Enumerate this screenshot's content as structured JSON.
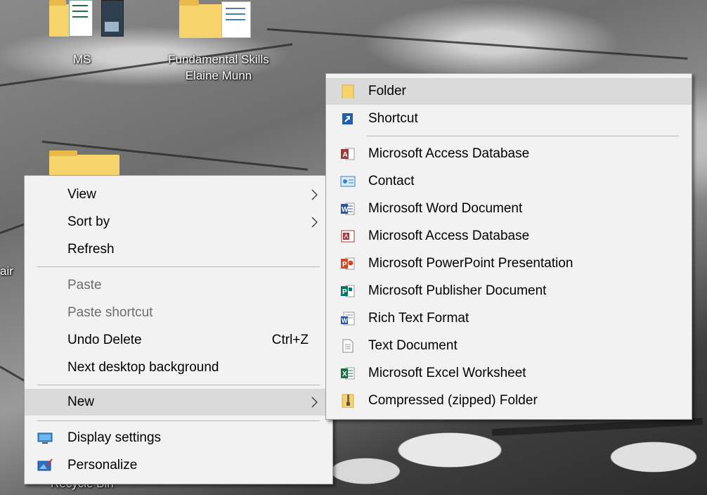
{
  "desktop": {
    "icons": [
      {
        "label": "MS"
      },
      {
        "label_line1": "Fundamental Skills",
        "label_line2": "Elaine Munn"
      },
      {
        "label": "air"
      },
      {
        "label": "Recycle Bin"
      }
    ]
  },
  "context_menu": {
    "view": "View",
    "sort_by": "Sort by",
    "refresh": "Refresh",
    "paste": "Paste",
    "paste_shortcut": "Paste shortcut",
    "undo_delete": "Undo Delete",
    "undo_shortcut": "Ctrl+Z",
    "next_background": "Next desktop background",
    "new": "New",
    "display_settings": "Display settings",
    "personalize": "Personalize"
  },
  "new_submenu": {
    "items": [
      {
        "label": "Folder",
        "icon": "folder-icon"
      },
      {
        "label": "Shortcut",
        "icon": "shortcut-icon"
      },
      {
        "label": "Microsoft Access Database",
        "icon": "access-icon"
      },
      {
        "label": "Contact",
        "icon": "contact-icon"
      },
      {
        "label": "Microsoft Word Document",
        "icon": "word-icon"
      },
      {
        "label": "Microsoft Access Database",
        "icon": "access-icon"
      },
      {
        "label": "Microsoft PowerPoint Presentation",
        "icon": "powerpoint-icon"
      },
      {
        "label": "Microsoft Publisher Document",
        "icon": "publisher-icon"
      },
      {
        "label": "Rich Text Format",
        "icon": "rtf-icon"
      },
      {
        "label": "Text Document",
        "icon": "text-document-icon"
      },
      {
        "label": "Microsoft Excel Worksheet",
        "icon": "excel-icon"
      },
      {
        "label": "Compressed (zipped) Folder",
        "icon": "zip-folder-icon"
      }
    ]
  },
  "colors": {
    "menu_bg": "#f2f2f2",
    "highlight": "#dadada",
    "disabled_text": "#6d6d6d"
  }
}
